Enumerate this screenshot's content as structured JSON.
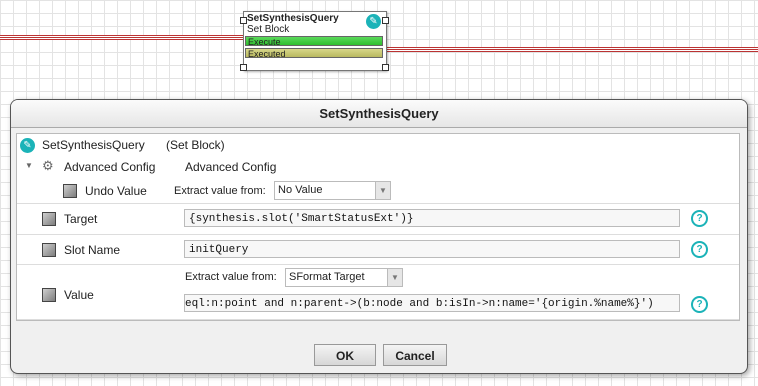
{
  "node": {
    "title": "SetSynthesisQuery",
    "subtitle": "Set Block",
    "slots": [
      "Execute",
      "Executed"
    ],
    "edit_icon": "pencil-icon"
  },
  "dialog": {
    "title": "SetSynthesisQuery",
    "header": {
      "name": "SetSynthesisQuery",
      "type": "(Set Block)"
    },
    "advanced": {
      "label": "Advanced Config",
      "value": "Advanced Config"
    },
    "undo": {
      "label": "Undo Value",
      "extract_label": "Extract value from:",
      "extract_value": "No Value"
    },
    "target": {
      "label": "Target",
      "value": "{synthesis.slot('SmartStatusExt')}"
    },
    "slot_name": {
      "label": "Slot Name",
      "value": "initQuery"
    },
    "value": {
      "label": "Value",
      "extract_label": "Extract value from:",
      "extract_value": "SFormat Target",
      "text": "eql:n:point and n:parent->(b:node and b:isIn->n:name='{origin.%name%}')"
    },
    "help": "?",
    "buttons": {
      "ok": "OK",
      "cancel": "Cancel"
    }
  },
  "colors": {
    "accent": "#1bb3b8",
    "wire": "#b33333",
    "execute": "#2fbf2f",
    "executed": "#b9b960"
  }
}
